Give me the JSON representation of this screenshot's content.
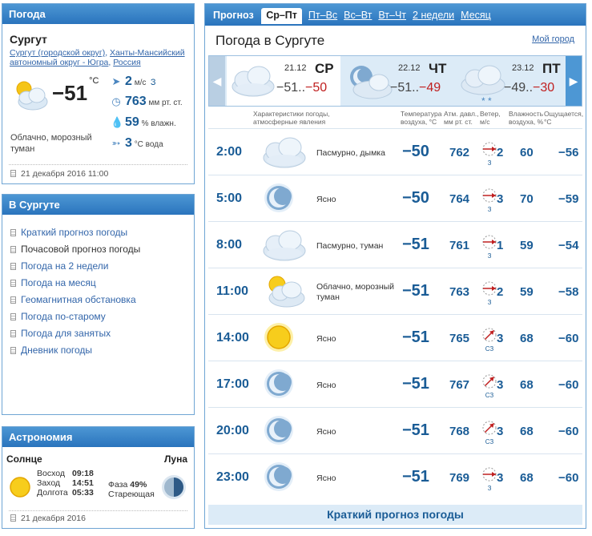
{
  "weather_box": {
    "title": "Погода",
    "city": "Сургут",
    "region_part1": "Сургут (городской округ)",
    "region_part2": "Ханты-Мансийский автономный округ - Югра",
    "region_part3": "Россия",
    "temperature": "−51",
    "temp_unit": "°C",
    "description": "Облачно, морозный туман",
    "wind_value": "2",
    "wind_unit": "м/с",
    "wind_dir": "З",
    "pressure_value": "763",
    "pressure_unit": "мм рт. ст.",
    "humidity_value": "59",
    "humidity_unit": "% влажн.",
    "water_value": "3",
    "water_unit": "°С вода",
    "updated": "21 декабря 2016 11:00"
  },
  "links_box": {
    "title": "В Сургуте",
    "items": [
      {
        "label": "Краткий прогноз погоды",
        "current": false
      },
      {
        "label": "Почасовой прогноз погоды",
        "current": true
      },
      {
        "label": "Погода на 2 недели",
        "current": false
      },
      {
        "label": "Погода на месяц",
        "current": false
      },
      {
        "label": "Геомагнитная обстановка",
        "current": false
      },
      {
        "label": "Погода по-старому",
        "current": false
      },
      {
        "label": "Погода для занятых",
        "current": false
      },
      {
        "label": "Дневник погоды",
        "current": false
      }
    ]
  },
  "astro_box": {
    "title": "Астрономия",
    "sun_label": "Солнце",
    "moon_label": "Луна",
    "sunrise_label": "Восход",
    "sunrise": "09:18",
    "sunset_label": "Заход",
    "sunset": "14:51",
    "daylength_label": "Долгота",
    "daylength": "05:33",
    "phase_label": "Фаза",
    "phase": "49%",
    "phase_name": "Стареющая",
    "date": "21 декабря 2016"
  },
  "tabs": {
    "first": "Прогноз",
    "items": [
      "Ср–Пт",
      "Пт–Вс",
      "Вс–Вт",
      "Вт–Чт",
      "2 недели",
      "Месяц"
    ],
    "active": 0
  },
  "main": {
    "title": "Погода в Сургуте",
    "my_city": "Мой город",
    "footer": "Краткий прогноз погоды"
  },
  "days": [
    {
      "date": "21.12",
      "weekday": "СР",
      "tmin": "−51..",
      "tmax": "−50",
      "icon": "overcast-cloud-icon"
    },
    {
      "date": "22.12",
      "weekday": "ЧТ",
      "tmin": "−51..",
      "tmax": "−49",
      "icon": "moon-cloud-icon"
    },
    {
      "date": "23.12",
      "weekday": "ПТ",
      "tmin": "−49..",
      "tmax": "−30",
      "icon": "snow-cloud-icon"
    }
  ],
  "columns": {
    "desc": "Характеристики погоды, атмосферные явления",
    "temp": "Температура воздуха, °С",
    "press": "Атм. давл., мм рт. ст.",
    "wind": "Ветер, м/с",
    "hum": "Влажность воздуха, %",
    "feels": "Ощущается, °С"
  },
  "rows": [
    {
      "time": "2:00",
      "icon": "overcast-cloud-icon",
      "desc": "Пасмурно, дымка",
      "temp": "−50",
      "press": "762",
      "wind": "2",
      "wind_dir": "З",
      "hum": "60",
      "feels": "−56"
    },
    {
      "time": "5:00",
      "icon": "moon-icon",
      "desc": "Ясно",
      "temp": "−50",
      "press": "764",
      "wind": "3",
      "wind_dir": "З",
      "hum": "70",
      "feels": "−59"
    },
    {
      "time": "8:00",
      "icon": "overcast-cloud-icon",
      "desc": "Пасмурно, туман",
      "temp": "−51",
      "press": "761",
      "wind": "1",
      "wind_dir": "З",
      "hum": "59",
      "feels": "−54"
    },
    {
      "time": "11:00",
      "icon": "sun-cloud-icon",
      "desc": "Облачно, морозный туман",
      "temp": "−51",
      "press": "763",
      "wind": "2",
      "wind_dir": "З",
      "hum": "59",
      "feels": "−58"
    },
    {
      "time": "14:00",
      "icon": "sun-icon",
      "desc": "Ясно",
      "temp": "−51",
      "press": "765",
      "wind": "3",
      "wind_dir": "СЗ",
      "hum": "68",
      "feels": "−60"
    },
    {
      "time": "17:00",
      "icon": "moon-icon",
      "desc": "Ясно",
      "temp": "−51",
      "press": "767",
      "wind": "3",
      "wind_dir": "СЗ",
      "hum": "68",
      "feels": "−60"
    },
    {
      "time": "20:00",
      "icon": "moon-icon",
      "desc": "Ясно",
      "temp": "−51",
      "press": "768",
      "wind": "3",
      "wind_dir": "СЗ",
      "hum": "68",
      "feels": "−60"
    },
    {
      "time": "23:00",
      "icon": "moon-icon",
      "desc": "Ясно",
      "temp": "−51",
      "press": "769",
      "wind": "3",
      "wind_dir": "З",
      "hum": "68",
      "feels": "−60"
    }
  ]
}
